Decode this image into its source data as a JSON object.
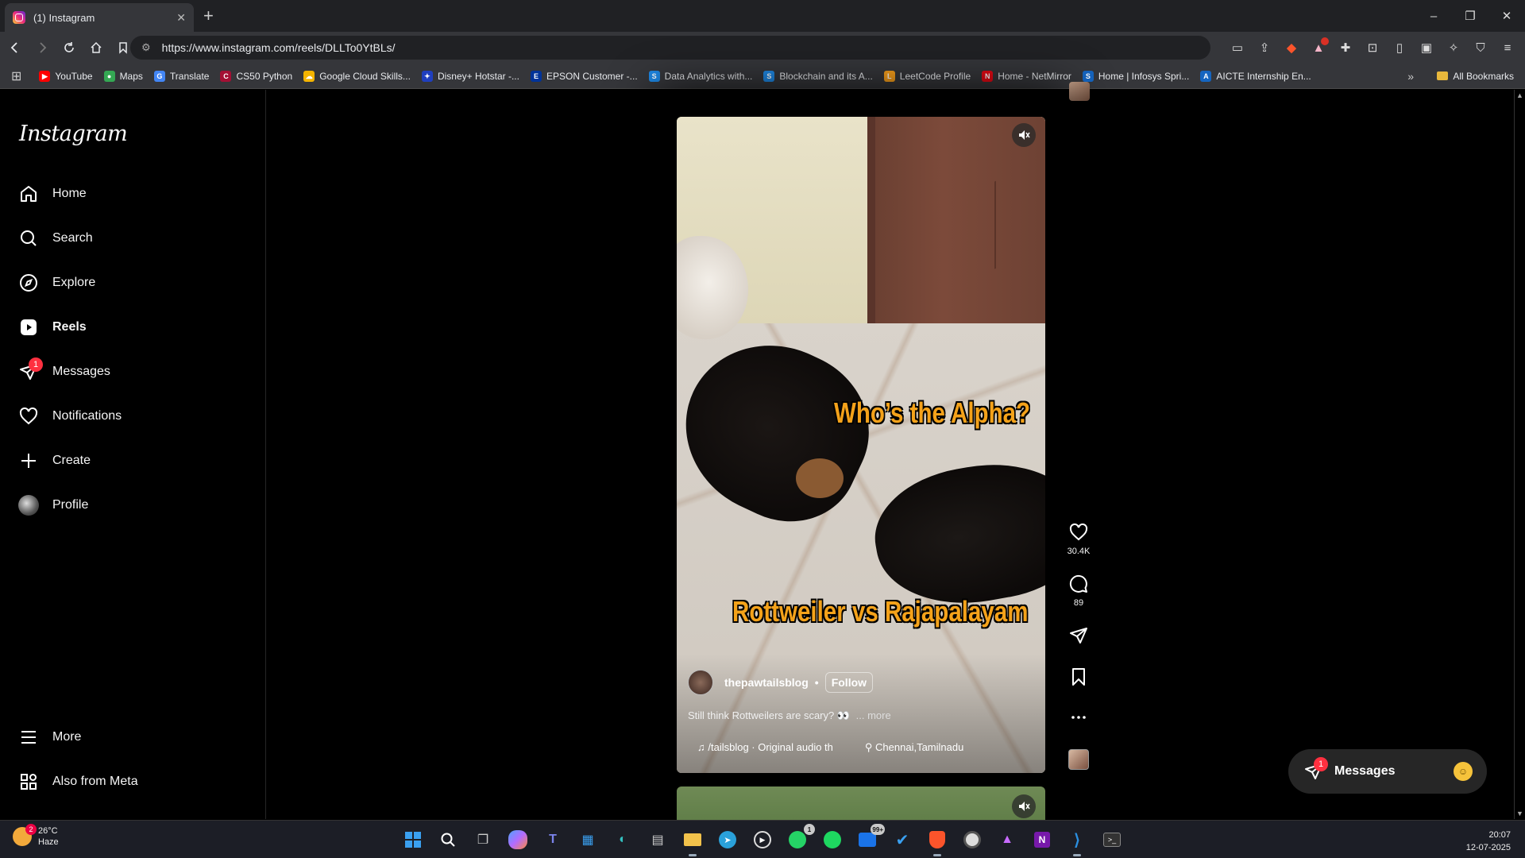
{
  "browser": {
    "tab_title": "(1) Instagram",
    "tab_close": "✕",
    "new_tab": "+",
    "url": "https://www.instagram.com/reels/DLLTo0YtBLs/",
    "window_controls": [
      "–",
      "❐",
      "✕"
    ]
  },
  "bookmarks": {
    "items": [
      {
        "label": "YouTube",
        "color": "#ff0000",
        "glyph": "▶"
      },
      {
        "label": "Maps",
        "color": "#34a853",
        "glyph": "●"
      },
      {
        "label": "Translate",
        "color": "#4285f4",
        "glyph": "G"
      },
      {
        "label": "CS50 Python",
        "color": "#a41034",
        "glyph": "C"
      },
      {
        "label": "Google Cloud Skills...",
        "color": "#f4b400",
        "glyph": "☁"
      },
      {
        "label": "Disney+ Hotstar -...",
        "color": "#1f3fbf",
        "glyph": "✦"
      },
      {
        "label": "EPSON Customer -...",
        "color": "#003399",
        "glyph": "E"
      },
      {
        "label": "Data Analytics with...",
        "color": "#1e88e5",
        "glyph": "S"
      },
      {
        "label": "Blockchain and its A...",
        "color": "#1e88e5",
        "glyph": "S"
      },
      {
        "label": "LeetCode Profile",
        "color": "#f89f1b",
        "glyph": "L"
      },
      {
        "label": "Home - NetMirror",
        "color": "#e50914",
        "glyph": "N"
      },
      {
        "label": "Home | Infosys Spri...",
        "color": "#1565c0",
        "glyph": "S"
      },
      {
        "label": "AICTE Internship En...",
        "color": "#1565c0",
        "glyph": "A"
      }
    ],
    "more": "»",
    "all_bookmarks": "All Bookmarks"
  },
  "sidebar": {
    "logo": "Instagram",
    "items": [
      {
        "label": "Home",
        "icon": "home-icon"
      },
      {
        "label": "Search",
        "icon": "search-icon"
      },
      {
        "label": "Explore",
        "icon": "explore-icon"
      },
      {
        "label": "Reels",
        "icon": "reels-icon",
        "active": true
      },
      {
        "label": "Messages",
        "icon": "messages-icon",
        "badge": "1"
      },
      {
        "label": "Notifications",
        "icon": "heart-icon"
      },
      {
        "label": "Create",
        "icon": "plus-icon"
      },
      {
        "label": "Profile",
        "icon": "avatar"
      }
    ],
    "more": "More",
    "also_from_meta": "Also from Meta"
  },
  "reel": {
    "overlay_top": "Who’s the Alpha?",
    "overlay_bottom": "Rottweiler vs Rajapalayam",
    "author": "thepawtailsblog",
    "dot": "•",
    "follow": "Follow",
    "description": "Still think Rottweilers are scary? 👀",
    "more": "... more",
    "audio": "♫ /tailsblog · Original audio   th",
    "location": "⚲ Chennai,Tamilnadu",
    "likes": "30.4K",
    "comments": "89"
  },
  "messages_pill": {
    "label": "Messages",
    "badge": "1",
    "avatar_glyph": "☺"
  },
  "taskbar": {
    "temp": "26°C",
    "condition": "Haze",
    "weather_badge": "2",
    "whatsapp_badge": "1",
    "mail_badge": "99+",
    "time": "20:07",
    "date": "12-07-2025"
  },
  "colors": {
    "accent_overlay_text": "#f4a21a",
    "badge_red": "#ff3040"
  }
}
